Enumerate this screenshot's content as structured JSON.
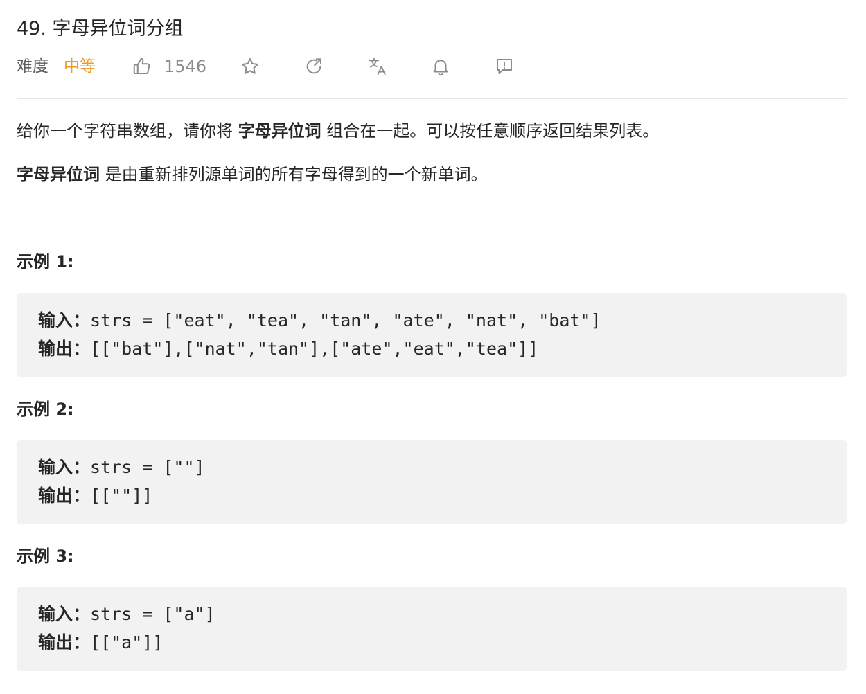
{
  "problem": {
    "title": "49. 字母异位词分组",
    "difficulty_label": "难度",
    "difficulty": "中等",
    "likes": "1546"
  },
  "icons": {
    "like": "thumbs-up-icon",
    "favorite": "star-icon",
    "share": "share-icon",
    "translate": "translate-icon",
    "notify": "bell-icon",
    "feedback": "feedback-icon"
  },
  "description": {
    "p1_a": "给你一个字符串数组，请你将 ",
    "p1_b": "字母异位词",
    "p1_c": " 组合在一起。可以按任意顺序返回结果列表。",
    "p2_a": "字母异位词",
    "p2_b": " 是由重新排列源单词的所有字母得到的一个新单词。"
  },
  "examples": [
    {
      "title": "示例 1:",
      "input_label": "输入：",
      "input": "strs = [\"eat\", \"tea\", \"tan\", \"ate\", \"nat\", \"bat\"]",
      "output_label": "输出：",
      "output": "[[\"bat\"],[\"nat\",\"tan\"],[\"ate\",\"eat\",\"tea\"]]"
    },
    {
      "title": "示例 2:",
      "input_label": "输入：",
      "input": "strs = [\"\"]",
      "output_label": "输出：",
      "output": "[[\"\"]]"
    },
    {
      "title": "示例 3:",
      "input_label": "输入：",
      "input": "strs = [\"a\"]",
      "output_label": "输出：",
      "output": "[[\"a\"]]"
    }
  ],
  "colors": {
    "difficulty_medium": "#ef9b27",
    "icon_gray": "#8c8c8c",
    "code_bg": "#f2f2f2",
    "divider": "#e6e6e6"
  }
}
